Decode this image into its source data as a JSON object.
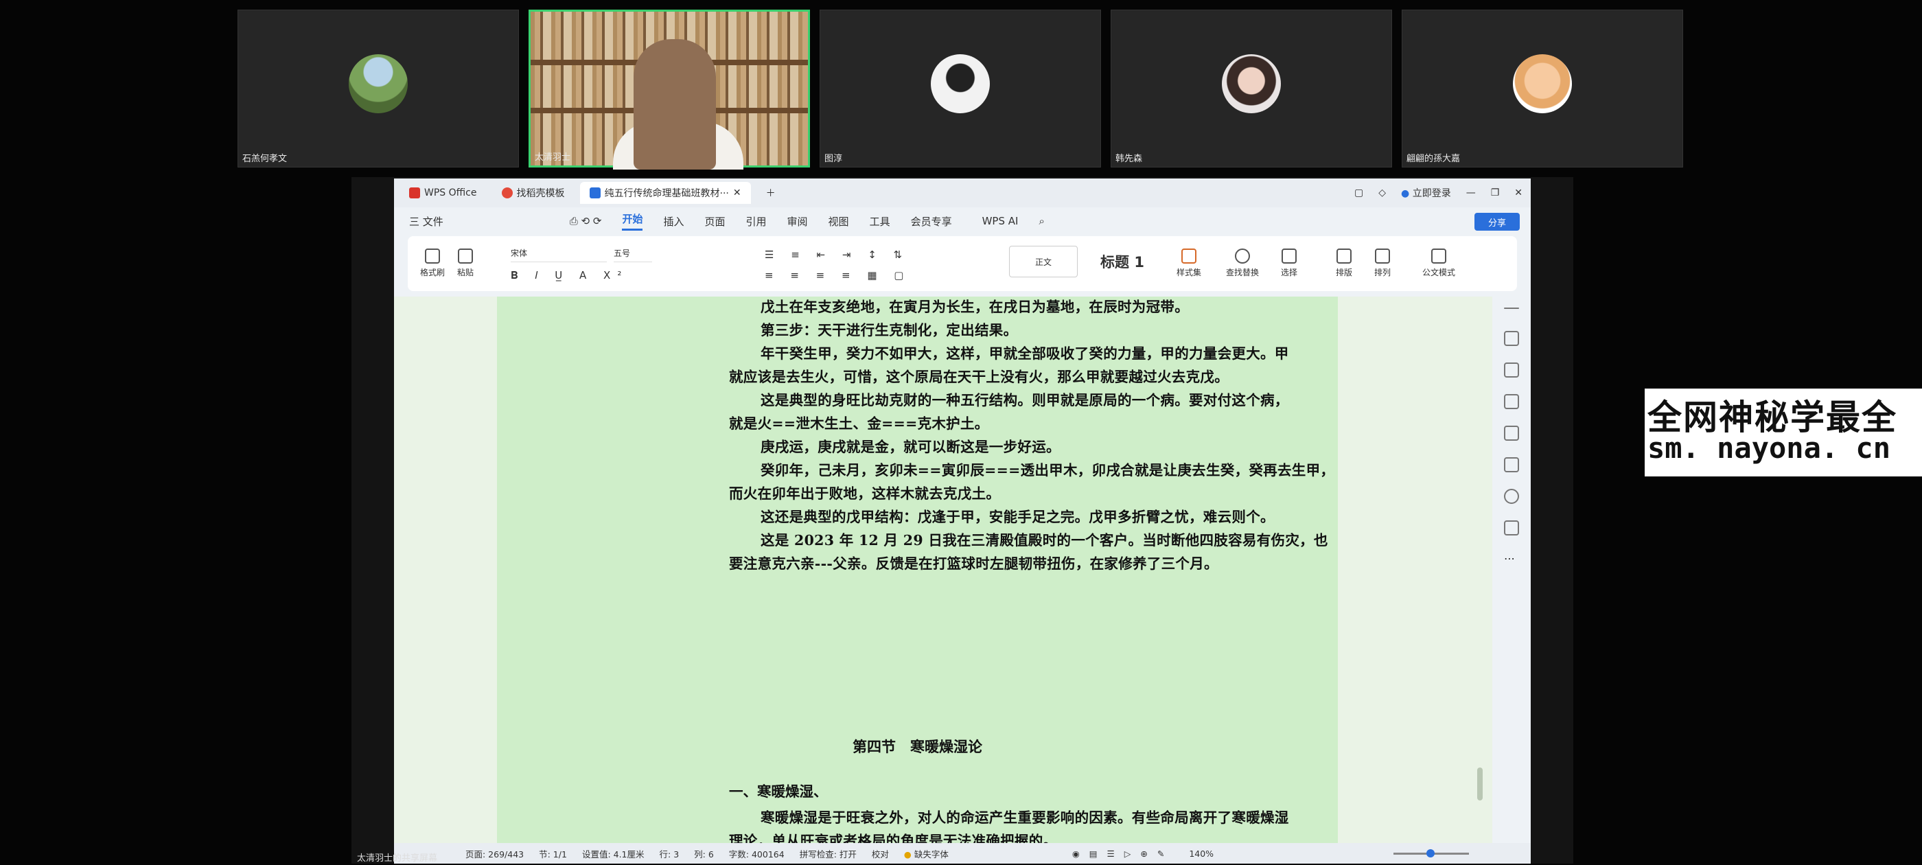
{
  "participants": [
    {
      "name": "石羔何孝文",
      "type": "avatar"
    },
    {
      "name": "太清羽士",
      "type": "video",
      "active": true
    },
    {
      "name": "图淳",
      "type": "avatar"
    },
    {
      "name": "韩先森",
      "type": "avatar"
    },
    {
      "name": "翩翩的孫大嘉",
      "type": "avatar"
    }
  ],
  "share_label": "太清羽士的共享屏幕",
  "wps": {
    "tabs": [
      "WPS Office",
      "找稻壳模板",
      "纯五行传统命理基础班教材···"
    ],
    "login": "立即登录",
    "menu": [
      "三 文件",
      "开始",
      "插入",
      "页面",
      "引用",
      "审阅",
      "视图",
      "工具",
      "会员专享",
      "WPS AI"
    ],
    "share_button": "分享",
    "ribbon": {
      "format_painter": "格式刷",
      "paste": "粘贴",
      "font": "宋体",
      "size": "五号",
      "style_normal": "正文",
      "style_h1": "标题 1",
      "styles": "样式集",
      "find_replace": "查找替换",
      "select": "选择",
      "layout": "排版",
      "arrange": "排列",
      "official": "公文模式"
    },
    "document": {
      "lines": [
        {
          "indent": true,
          "text": "戊土在年支亥绝地，在寅月为长生，在戌日为墓地，在辰时为冠带。"
        },
        {
          "indent": true,
          "text": "第三步：天干进行生克制化，定出结果。"
        },
        {
          "indent": true,
          "text": "年干癸生甲，癸力不如甲大，这样，甲就全部吸收了癸的力量，甲的力量会更大。甲"
        },
        {
          "indent": false,
          "text": "就应该是去生火，可惜，这个原局在天干上没有火，那么甲就要越过火去克戊。"
        },
        {
          "indent": true,
          "text": "这是典型的身旺比劫克财的一种五行结构。则甲就是原局的一个病。要对付这个病，"
        },
        {
          "indent": false,
          "text": "就是火==泄木生土、金===克木护土。"
        },
        {
          "indent": true,
          "text": "庚戌运，庚戌就是金，就可以断这是一步好运。"
        },
        {
          "indent": true,
          "text": "癸卯年，己未月，亥卯未==寅卯辰===透出甲木，卯戌合就是让庚去生癸，癸再去生甲，"
        },
        {
          "indent": false,
          "text": "而火在卯年出于败地，这样木就去克戊土。"
        },
        {
          "indent": true,
          "text": "这还是典型的戊甲结构：戊逢于甲，安能手足之完。戊甲多折臂之忧，难云则个。"
        },
        {
          "indent": true,
          "text": "这是 2023 年 12 月 29 日我在三清殿值殿时的一个客户。当时断他四肢容易有伤灾，也"
        },
        {
          "indent": false,
          "text": "要注意克六亲---父亲。反馈是在打篮球时左腿韧带扭伤，在家修养了三个月。"
        }
      ],
      "heading": "第四节　寒暖燥湿论",
      "section": "一、寒暖燥湿、",
      "tail_lines": [
        {
          "indent": true,
          "text": "寒暖燥湿是于旺衰之外，对人的命运产生重要影响的因素。有些命局离开了寒暖燥湿"
        },
        {
          "indent": false,
          "text": "理论，单从旺衰或者格局的角度是无法准确把握的。"
        }
      ]
    },
    "status": {
      "page": "页面: 269/443",
      "section": "节: 1/1",
      "setting": "设置值: 4.1厘米",
      "row": "行: 3",
      "col": "列: 6",
      "words": "字数: 400164",
      "spell": "拼写检查: 打开",
      "proof": "校对",
      "font_missing": "缺失字体",
      "zoom": "140%"
    }
  },
  "watermark": {
    "line1": "全网神秘学最全",
    "line2": "sm. nayona. cn"
  }
}
